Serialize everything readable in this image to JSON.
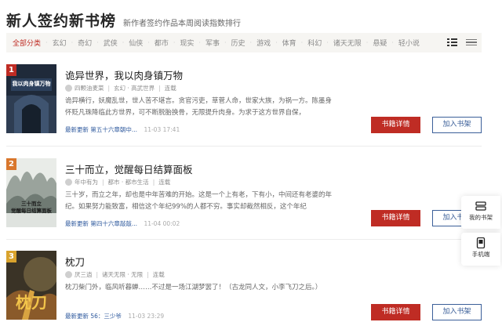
{
  "header": {
    "title": "新人签约新书榜",
    "subtitle": "新作者签约作品本周阅读指数排行"
  },
  "filters": [
    "全部分类",
    "玄幻",
    "奇幻",
    "武侠",
    "仙侠",
    "都市",
    "现实",
    "军事",
    "历史",
    "游戏",
    "体育",
    "科幻",
    "诸天无限",
    "悬疑",
    "轻小说"
  ],
  "colors": {
    "accent": "#bf2c24",
    "link": "#2f5a9e"
  },
  "books": [
    {
      "rank": "1",
      "cover_text": "我以肉身镇万物",
      "title": "诡异世界，我以肉身镇万物",
      "author": "四颗油麦菜",
      "category": "玄幻 · 高武世界",
      "status": "连载",
      "desc": "诡异横行，妖魔乱世，世人苦不堪言。贪官污吏，草菅人命，世家大族，为祸一方。陈墨身怀贬凡珠降临此方世界，可不断脱胎换骨，无限提升肉身。为求于这方世界自保，",
      "latest_label": "最新更新 第五十六章朝中...",
      "latest_time": "11-03 17:41"
    },
    {
      "rank": "2",
      "cover_text": "三十而立\n觉醒每日结算面板",
      "title": "三十而立，觉醒每日结算面板",
      "author": "年中有为",
      "category": "都市 · 都市生活",
      "status": "连载",
      "desc": "三十岁，而立之年，却也是中年苦难的开始。这是一个上有老，下有小，中间还有老婆的年纪。如果努力能致富，相信这个年纪99%的人都不穷。事实却截然相反，这个年纪",
      "latest_label": "最新更新 第四十六章敲敲...",
      "latest_time": "11-04 00:02"
    },
    {
      "rank": "3",
      "cover_text": "枕刀",
      "title": "枕刀",
      "author": "厌三逍",
      "category": "诸天无限 · 无限",
      "status": "连载",
      "desc": "枕刀柴门外，临风听暮蝉……不过是一场江湖梦罢了！（古龙同人文，小李飞刀之后。）",
      "latest_label": "最新更新 56：三少爷",
      "latest_time": "11-03 23:29"
    }
  ],
  "buttons": {
    "detail": "书籍详情",
    "shelf": "加入书架"
  },
  "float": {
    "bookshelf": "我的书架",
    "mobile": "手机端"
  }
}
